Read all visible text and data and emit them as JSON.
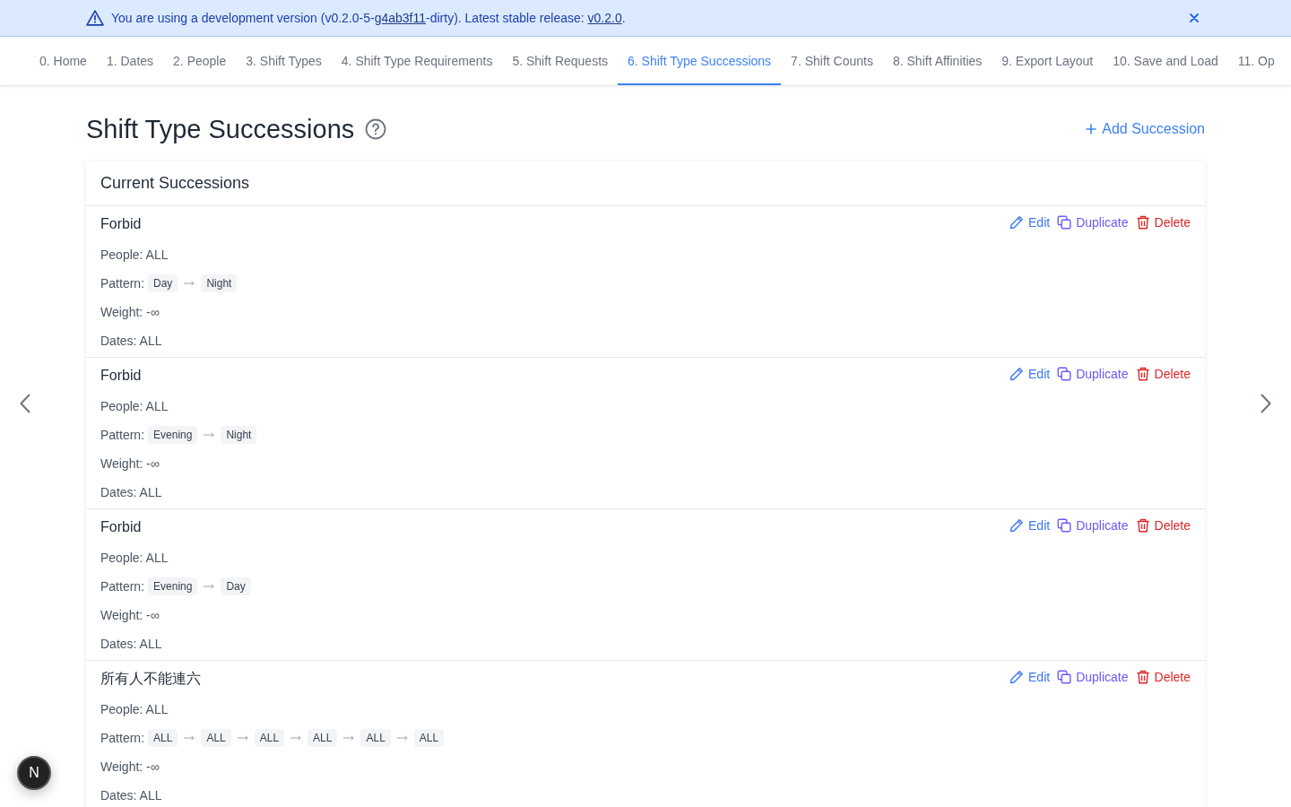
{
  "banner": {
    "segments": [
      {
        "kind": "text",
        "text": "You are using a development version (v0.2.0-5-"
      },
      {
        "kind": "link",
        "text": "g4ab3f11"
      },
      {
        "kind": "text",
        "text": "-dirty). Latest stable release: "
      },
      {
        "kind": "link",
        "text": "v0.2.0"
      },
      {
        "kind": "text",
        "text": "."
      }
    ]
  },
  "tabs": [
    {
      "label": "0. Home",
      "selected": false
    },
    {
      "label": "1. Dates",
      "selected": false
    },
    {
      "label": "2. People",
      "selected": false
    },
    {
      "label": "3. Shift Types",
      "selected": false
    },
    {
      "label": "4. Shift Type Requirements",
      "selected": false
    },
    {
      "label": "5. Shift Requests",
      "selected": false
    },
    {
      "label": "6. Shift Type Successions",
      "selected": true
    },
    {
      "label": "7. Shift Counts",
      "selected": false
    },
    {
      "label": "8. Shift Affinities",
      "selected": false
    },
    {
      "label": "9. Export Layout",
      "selected": false
    },
    {
      "label": "10. Save and Load",
      "selected": false
    },
    {
      "label": "11. Op",
      "selected": false
    }
  ],
  "page": {
    "title": "Shift Type Successions",
    "add_button": "Add Succession"
  },
  "card": {
    "title": "Current Successions",
    "items": [
      {
        "title": "Forbid",
        "people": "People: ALL",
        "pattern_label": "Pattern:",
        "pattern": [
          "Day",
          "Night"
        ],
        "weight": "Weight: -∞",
        "dates": "Dates: ALL",
        "actions": [
          {
            "kind": "edit",
            "label": "Edit"
          },
          {
            "kind": "duplicate",
            "label": "Duplicate"
          },
          {
            "kind": "delete",
            "label": "Delete"
          }
        ]
      },
      {
        "title": "Forbid",
        "people": "People: ALL",
        "pattern_label": "Pattern:",
        "pattern": [
          "Evening",
          "Night"
        ],
        "weight": "Weight: -∞",
        "dates": "Dates: ALL",
        "actions": [
          {
            "kind": "edit",
            "label": "Edit"
          },
          {
            "kind": "duplicate",
            "label": "Duplicate"
          },
          {
            "kind": "delete",
            "label": "Delete"
          }
        ]
      },
      {
        "title": "Forbid",
        "people": "People: ALL",
        "pattern_label": "Pattern:",
        "pattern": [
          "Evening",
          "Day"
        ],
        "weight": "Weight: -∞",
        "dates": "Dates: ALL",
        "actions": [
          {
            "kind": "edit",
            "label": "Edit"
          },
          {
            "kind": "duplicate",
            "label": "Duplicate"
          },
          {
            "kind": "delete",
            "label": "Delete"
          }
        ]
      },
      {
        "title": "所有人不能連六",
        "people": "People: ALL",
        "pattern_label": "Pattern:",
        "pattern": [
          "ALL",
          "ALL",
          "ALL",
          "ALL",
          "ALL",
          "ALL"
        ],
        "weight": "Weight: -∞",
        "dates": "Dates: ALL",
        "actions": [
          {
            "kind": "edit",
            "label": "Edit"
          },
          {
            "kind": "duplicate",
            "label": "Duplicate"
          },
          {
            "kind": "delete",
            "label": "Delete"
          }
        ]
      }
    ]
  },
  "dev_badge": {
    "label": "N"
  }
}
